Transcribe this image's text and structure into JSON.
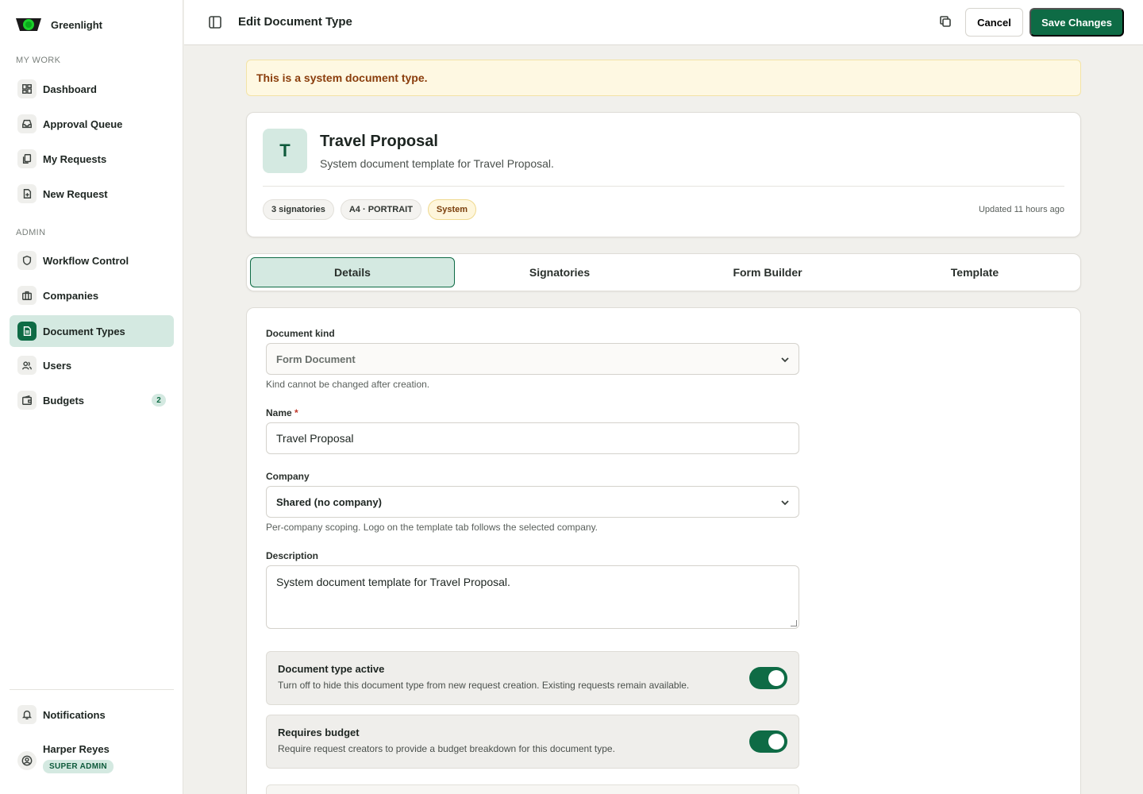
{
  "brand": {
    "name": "Greenlight"
  },
  "sidebar": {
    "my_work_label": "MY WORK",
    "admin_label": "ADMIN",
    "my_work": [
      {
        "label": "Dashboard",
        "icon": "dashboard-icon"
      },
      {
        "label": "Approval Queue",
        "icon": "inbox-icon"
      },
      {
        "label": "My Requests",
        "icon": "files-icon"
      },
      {
        "label": "New Request",
        "icon": "file-plus-icon"
      }
    ],
    "admin": [
      {
        "label": "Workflow Control",
        "icon": "shield-icon"
      },
      {
        "label": "Companies",
        "icon": "briefcase-icon"
      },
      {
        "label": "Document Types",
        "icon": "document-icon",
        "active": true
      },
      {
        "label": "Users",
        "icon": "users-icon"
      },
      {
        "label": "Budgets",
        "icon": "wallet-icon",
        "badge": "2"
      }
    ],
    "notifications_label": "Notifications",
    "user": {
      "name": "Harper Reyes",
      "role": "SUPER ADMIN"
    }
  },
  "topbar": {
    "title": "Edit Document Type",
    "cancel_label": "Cancel",
    "save_label": "Save Changes"
  },
  "alert": {
    "text": "This is a system document type."
  },
  "doc": {
    "initial": "T",
    "name": "Travel Proposal",
    "description": "System document template for Travel Proposal.",
    "chips": [
      "3 signatories",
      "A4 · PORTRAIT",
      "System"
    ],
    "updated": "Updated 11 hours ago"
  },
  "tabs": [
    "Details",
    "Signatories",
    "Form Builder",
    "Template"
  ],
  "form": {
    "kind_label": "Document kind",
    "kind_value": "Form Document",
    "kind_hint": "Kind cannot be changed after creation.",
    "name_label": "Name",
    "name_required": "*",
    "name_value": "Travel Proposal",
    "company_label": "Company",
    "company_value": "Shared (no company)",
    "company_hint": "Per-company scoping. Logo on the template tab follows the selected company.",
    "description_label": "Description",
    "description_value": "System document template for Travel Proposal.",
    "active_title": "Document type active",
    "active_desc": "Turn off to hide this document type from new request creation. Existing requests remain available.",
    "budget_title": "Requires budget",
    "budget_desc": "Require request creators to provide a budget breakdown for this document type."
  },
  "colors": {
    "accent": "#0e6b45",
    "accent_light": "#d4e9e1",
    "alert_bg": "#fef8e2",
    "alert_text": "#8a3d0c"
  }
}
